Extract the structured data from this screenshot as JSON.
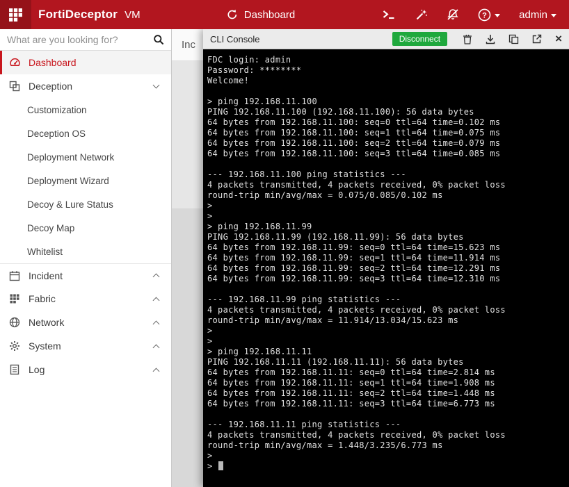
{
  "topbar": {
    "brand": "FortiDeceptor",
    "edition": "VM",
    "nav_title": "Dashboard",
    "brand_color": "#b2161f",
    "actions": [
      {
        "id": "cli-console",
        "icon": "terminal-icon"
      },
      {
        "id": "deployment-wizard",
        "icon": "wand-icon"
      },
      {
        "id": "notifications-muted",
        "icon": "bell-slash-icon"
      },
      {
        "id": "help-menu",
        "icon": "help-icon",
        "caret": true
      },
      {
        "id": "user-menu",
        "label": "admin",
        "caret": true
      }
    ]
  },
  "sidebar": {
    "search_placeholder": "What are you looking for?",
    "search_value": "",
    "items": [
      {
        "id": "dashboard",
        "label": "Dashboard",
        "icon": "dashboard-icon",
        "active": true
      },
      {
        "id": "deception",
        "label": "Deception",
        "icon": "deception-icon",
        "chevron": "down",
        "children": [
          {
            "id": "customization",
            "label": "Customization"
          },
          {
            "id": "deception-os",
            "label": "Deception OS"
          },
          {
            "id": "deployment-network",
            "label": "Deployment Network"
          },
          {
            "id": "deployment-wizard",
            "label": "Deployment Wizard"
          },
          {
            "id": "decoy-lure-status",
            "label": "Decoy & Lure Status"
          },
          {
            "id": "decoy-map",
            "label": "Decoy Map"
          },
          {
            "id": "whitelist",
            "label": "Whitelist"
          }
        ]
      },
      {
        "id": "incident",
        "label": "Incident",
        "icon": "incident-icon",
        "chevron": "up"
      },
      {
        "id": "fabric",
        "label": "Fabric",
        "icon": "fabric-icon",
        "chevron": "up"
      },
      {
        "id": "network",
        "label": "Network",
        "icon": "network-icon",
        "chevron": "up"
      },
      {
        "id": "system",
        "label": "System",
        "icon": "system-icon",
        "chevron": "up"
      },
      {
        "id": "log",
        "label": "Log",
        "icon": "log-icon",
        "chevron": "up"
      }
    ]
  },
  "background": {
    "partial_panel_title": "Inc"
  },
  "console": {
    "title": "CLI Console",
    "disconnect_label": "Disconnect",
    "disconnect_color": "#1fa83d",
    "tools": [
      {
        "id": "clear",
        "icon": "trash-icon"
      },
      {
        "id": "download",
        "icon": "download-icon"
      },
      {
        "id": "copy",
        "icon": "copy-icon"
      },
      {
        "id": "open-new-window",
        "icon": "external-icon"
      },
      {
        "id": "close",
        "icon": "close-icon"
      }
    ],
    "terminal_lines": [
      "FDC login: admin",
      "Password: ********",
      "Welcome!",
      "",
      "> ping 192.168.11.100",
      "PING 192.168.11.100 (192.168.11.100): 56 data bytes",
      "64 bytes from 192.168.11.100: seq=0 ttl=64 time=0.102 ms",
      "64 bytes from 192.168.11.100: seq=1 ttl=64 time=0.075 ms",
      "64 bytes from 192.168.11.100: seq=2 ttl=64 time=0.079 ms",
      "64 bytes from 192.168.11.100: seq=3 ttl=64 time=0.085 ms",
      "",
      "--- 192.168.11.100 ping statistics ---",
      "4 packets transmitted, 4 packets received, 0% packet loss",
      "round-trip min/avg/max = 0.075/0.085/0.102 ms",
      ">",
      ">",
      "> ping 192.168.11.99",
      "PING 192.168.11.99 (192.168.11.99): 56 data bytes",
      "64 bytes from 192.168.11.99: seq=0 ttl=64 time=15.623 ms",
      "64 bytes from 192.168.11.99: seq=1 ttl=64 time=11.914 ms",
      "64 bytes from 192.168.11.99: seq=2 ttl=64 time=12.291 ms",
      "64 bytes from 192.168.11.99: seq=3 ttl=64 time=12.310 ms",
      "",
      "--- 192.168.11.99 ping statistics ---",
      "4 packets transmitted, 4 packets received, 0% packet loss",
      "round-trip min/avg/max = 11.914/13.034/15.623 ms",
      ">",
      ">",
      "> ping 192.168.11.11",
      "PING 192.168.11.11 (192.168.11.11): 56 data bytes",
      "64 bytes from 192.168.11.11: seq=0 ttl=64 time=2.814 ms",
      "64 bytes from 192.168.11.11: seq=1 ttl=64 time=1.908 ms",
      "64 bytes from 192.168.11.11: seq=2 ttl=64 time=1.448 ms",
      "64 bytes from 192.168.11.11: seq=3 ttl=64 time=6.773 ms",
      "",
      "--- 192.168.11.11 ping statistics ---",
      "4 packets transmitted, 4 packets received, 0% packet loss",
      "round-trip min/avg/max = 1.448/3.235/6.773 ms",
      ">",
      "> "
    ]
  }
}
